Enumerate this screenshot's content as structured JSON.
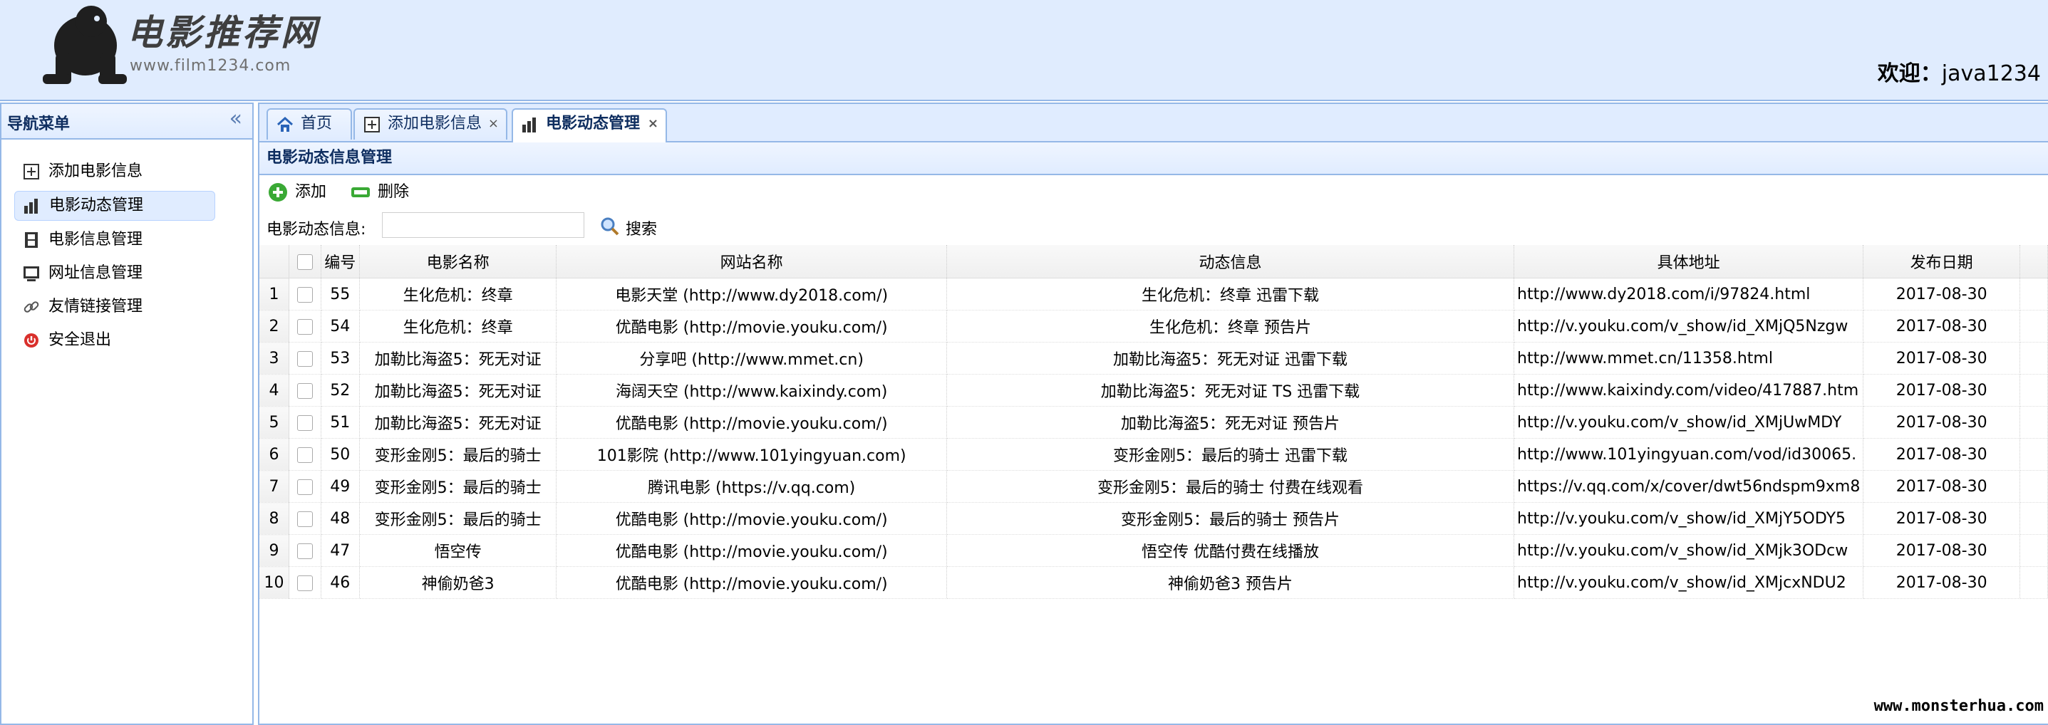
{
  "header": {
    "logo_title": "电影推荐网",
    "logo_sub": "www.film1234.com",
    "welcome_prefix": "欢迎：",
    "username": "java1234"
  },
  "sidebar": {
    "title": "导航菜单",
    "collapse_icon": "«",
    "items": [
      {
        "label": "添加电影信息",
        "icon": "add-square-icon"
      },
      {
        "label": "电影动态管理",
        "icon": "bar-chart-icon"
      },
      {
        "label": "电影信息管理",
        "icon": "film-icon"
      },
      {
        "label": "网址信息管理",
        "icon": "monitor-icon"
      },
      {
        "label": "友情链接管理",
        "icon": "link-icon"
      },
      {
        "label": "安全退出",
        "icon": "exit-icon"
      }
    ]
  },
  "tabs": [
    {
      "label": "首页",
      "icon": "home-icon"
    },
    {
      "label": "添加电影信息",
      "icon": "add-square-icon",
      "close": "×"
    },
    {
      "label": "电影动态管理",
      "icon": "bar-chart-icon",
      "close": "×"
    }
  ],
  "panel": {
    "title": "电影动态信息管理",
    "add_label": "添加",
    "delete_label": "删除",
    "search_label": "电影动态信息:",
    "search_value": "",
    "search_button": "搜索"
  },
  "grid": {
    "columns": [
      "编号",
      "电影名称",
      "网站名称",
      "动态信息",
      "具体地址",
      "发布日期"
    ],
    "rows": [
      {
        "rn": "1",
        "id": "55",
        "movie": "生化危机：终章",
        "site": "电影天堂 (http://www.dy2018.com/)",
        "info": "生化危机：终章 迅雷下载",
        "url": "http://www.dy2018.com/i/97824.html",
        "date": "2017-08-30"
      },
      {
        "rn": "2",
        "id": "54",
        "movie": "生化危机：终章",
        "site": "优酷电影 (http://movie.youku.com/)",
        "info": "生化危机：终章 预告片",
        "url": "http://v.youku.com/v_show/id_XMjQ5Nzgw",
        "date": "2017-08-30"
      },
      {
        "rn": "3",
        "id": "53",
        "movie": "加勒比海盗5：死无对证",
        "site": "分享吧 (http://www.mmet.cn)",
        "info": "加勒比海盗5：死无对证 迅雷下载",
        "url": "http://www.mmet.cn/11358.html",
        "date": "2017-08-30"
      },
      {
        "rn": "4",
        "id": "52",
        "movie": "加勒比海盗5：死无对证",
        "site": "海阔天空 (http://www.kaixindy.com)",
        "info": "加勒比海盗5：死无对证 TS 迅雷下载",
        "url": "http://www.kaixindy.com/video/417887.htm",
        "date": "2017-08-30"
      },
      {
        "rn": "5",
        "id": "51",
        "movie": "加勒比海盗5：死无对证",
        "site": "优酷电影 (http://movie.youku.com/)",
        "info": "加勒比海盗5：死无对证 预告片",
        "url": "http://v.youku.com/v_show/id_XMjUwMDY",
        "date": "2017-08-30"
      },
      {
        "rn": "6",
        "id": "50",
        "movie": "变形金刚5：最后的骑士",
        "site": "101影院 (http://www.101yingyuan.com)",
        "info": "变形金刚5：最后的骑士 迅雷下载",
        "url": "http://www.101yingyuan.com/vod/id30065.",
        "date": "2017-08-30"
      },
      {
        "rn": "7",
        "id": "49",
        "movie": "变形金刚5：最后的骑士",
        "site": "腾讯电影 (https://v.qq.com)",
        "info": "变形金刚5：最后的骑士 付费在线观看",
        "url": "https://v.qq.com/x/cover/dwt56ndspm9xm8",
        "date": "2017-08-30"
      },
      {
        "rn": "8",
        "id": "48",
        "movie": "变形金刚5：最后的骑士",
        "site": "优酷电影 (http://movie.youku.com/)",
        "info": "变形金刚5：最后的骑士 预告片",
        "url": "http://v.youku.com/v_show/id_XMjY5ODY5",
        "date": "2017-08-30"
      },
      {
        "rn": "9",
        "id": "47",
        "movie": "悟空传",
        "site": "优酷电影 (http://movie.youku.com/)",
        "info": "悟空传 优酷付费在线播放",
        "url": "http://v.youku.com/v_show/id_XMjk3ODcw",
        "date": "2017-08-30"
      },
      {
        "rn": "10",
        "id": "46",
        "movie": "神偷奶爸3",
        "site": "优酷电影 (http://movie.youku.com/)",
        "info": "神偷奶爸3 预告片",
        "url": "http://v.youku.com/v_show/id_XMjcxNDU2",
        "date": "2017-08-30"
      }
    ]
  },
  "watermark": "www.monsterhua.com",
  "colors": {
    "header_bg": "#e0ecfe",
    "border": "#95b8e7",
    "title_text": "#0e2d5f"
  }
}
